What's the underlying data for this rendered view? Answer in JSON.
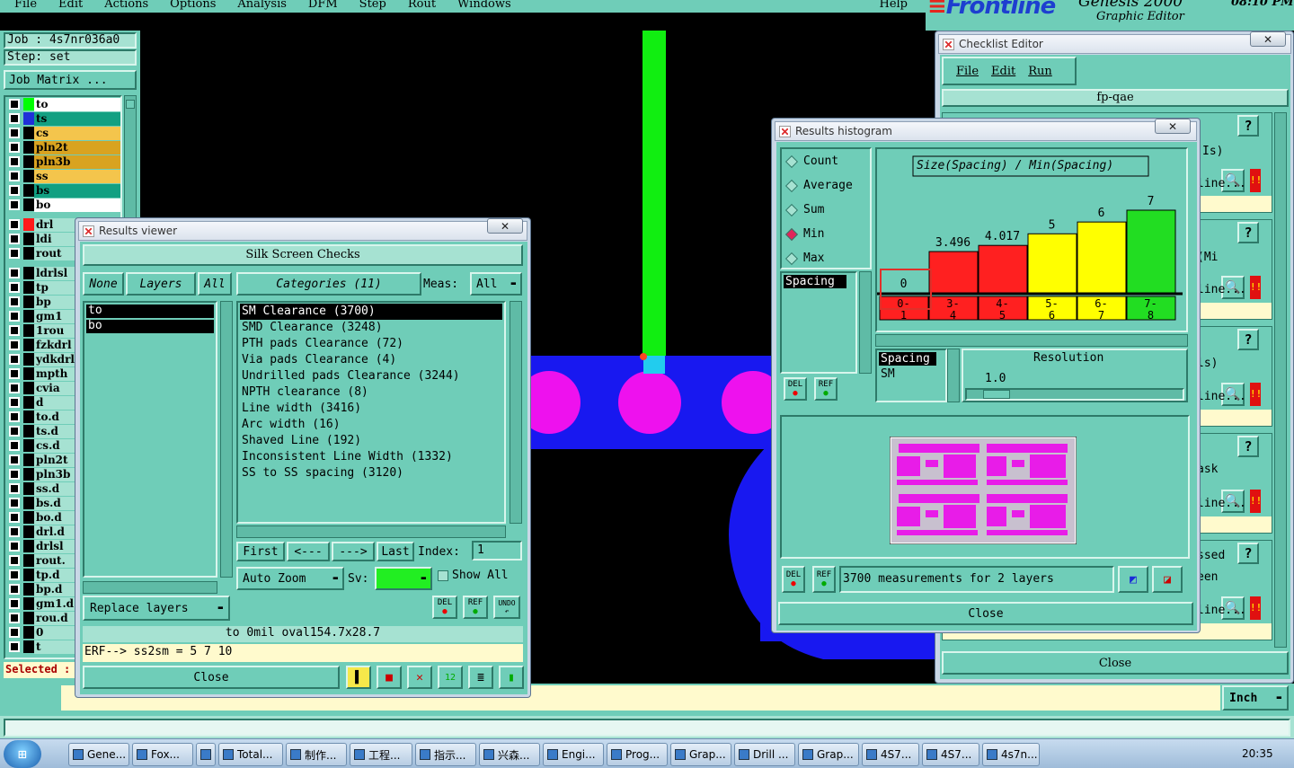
{
  "menubar": {
    "items": [
      "File",
      "Edit",
      "Actions",
      "Options",
      "Analysis",
      "DFM",
      "Step",
      "Rout",
      "Windows"
    ],
    "help": "Help"
  },
  "brand": {
    "logo": "Frontline",
    "product": "Genesis 2000",
    "subtitle": "Graphic Editor",
    "clock": "08:10 PM"
  },
  "job": {
    "job_label": "Job : 4s7nr036a0",
    "step_label": "Step: set",
    "matrix_button": "Job Matrix ..."
  },
  "layers": [
    {
      "name": "to",
      "color": "#ffffff",
      "indicator": "#00ff00"
    },
    {
      "name": "ts",
      "color": "#12a082",
      "indicator": "#1f2fd8"
    },
    {
      "name": "cs",
      "color": "#f4c54c",
      "indicator": ""
    },
    {
      "name": "pln2t",
      "color": "#d9a320",
      "indicator": ""
    },
    {
      "name": "pln3b",
      "color": "#d9a320",
      "indicator": ""
    },
    {
      "name": "ss",
      "color": "#f4c54c",
      "indicator": ""
    },
    {
      "name": "bs",
      "color": "#12a082",
      "indicator": ""
    },
    {
      "name": "bo",
      "color": "#ffffff",
      "indicator": ""
    },
    {
      "name": "drl",
      "color": "#a6e2d2",
      "indicator": "#ff1a1a"
    },
    {
      "name": "ldi",
      "color": "#a6e2d2",
      "indicator": ""
    },
    {
      "name": "rout",
      "color": "#a6e2d2",
      "indicator": ""
    },
    {
      "name": "ldrlsl",
      "color": "#a6e2d2",
      "indicator": ""
    },
    {
      "name": "tp",
      "color": "#a6e2d2",
      "indicator": ""
    },
    {
      "name": "bp",
      "color": "#a6e2d2",
      "indicator": ""
    },
    {
      "name": "gm1",
      "color": "#a6e2d2",
      "indicator": ""
    },
    {
      "name": "1rou",
      "color": "#a6e2d2",
      "indicator": ""
    },
    {
      "name": "fzkdrl",
      "color": "#a6e2d2",
      "indicator": ""
    },
    {
      "name": "ydkdrl",
      "color": "#a6e2d2",
      "indicator": ""
    },
    {
      "name": "mpth",
      "color": "#a6e2d2",
      "indicator": ""
    },
    {
      "name": "cvia",
      "color": "#a6e2d2",
      "indicator": ""
    },
    {
      "name": "d",
      "color": "#a6e2d2",
      "indicator": ""
    },
    {
      "name": "to.d",
      "color": "#a6e2d2",
      "indicator": ""
    },
    {
      "name": "ts.d",
      "color": "#a6e2d2",
      "indicator": ""
    },
    {
      "name": "cs.d",
      "color": "#a6e2d2",
      "indicator": ""
    },
    {
      "name": "pln2t",
      "color": "#a6e2d2",
      "indicator": ""
    },
    {
      "name": "pln3b",
      "color": "#a6e2d2",
      "indicator": ""
    },
    {
      "name": "ss.d",
      "color": "#a6e2d2",
      "indicator": ""
    },
    {
      "name": "bs.d",
      "color": "#a6e2d2",
      "indicator": ""
    },
    {
      "name": "bo.d",
      "color": "#a6e2d2",
      "indicator": ""
    },
    {
      "name": "drl.d",
      "color": "#a6e2d2",
      "indicator": ""
    },
    {
      "name": "drlsl",
      "color": "#a6e2d2",
      "indicator": ""
    },
    {
      "name": "rout.",
      "color": "#a6e2d2",
      "indicator": ""
    },
    {
      "name": "tp.d",
      "color": "#a6e2d2",
      "indicator": ""
    },
    {
      "name": "bp.d",
      "color": "#a6e2d2",
      "indicator": ""
    },
    {
      "name": "gm1.d",
      "color": "#a6e2d2",
      "indicator": ""
    },
    {
      "name": "rou.d",
      "color": "#a6e2d2",
      "indicator": ""
    },
    {
      "name": "0",
      "color": "#a6e2d2",
      "indicator": ""
    },
    {
      "name": "t",
      "color": "#a6e2d2",
      "indicator": ""
    }
  ],
  "selected_label": "Selected :",
  "results_viewer": {
    "title": "Results viewer",
    "header": "Silk Screen Checks",
    "btn_none": "None",
    "btn_layers": "Layers",
    "btn_all": "All",
    "categories_label": "Categories (11)",
    "meas_label": "Meas:",
    "meas_value": "All",
    "layer_list": [
      "to",
      "bo"
    ],
    "categories": [
      "SM Clearance (3700)",
      "SMD Clearance (3248)",
      "PTH pads Clearance (72)",
      "Via pads Clearance (4)",
      "Undrilled pads Clearance (3244)",
      "NPTH clearance (8)",
      "Line width (3416)",
      "Arc width (16)",
      "Shaved Line (192)",
      "Inconsistent Line Width (1332)",
      "SS to SS spacing (3120)"
    ],
    "first": "First",
    "prev": "<---",
    "next": "--->",
    "last": "Last",
    "index_label": "Index:",
    "index_value": "1",
    "auto_zoom": "Auto Zoom",
    "sv_label": "Sv:",
    "show_all": "Show All",
    "replace_layers": "Replace layers",
    "del": "DEL",
    "ref": "REF",
    "undo": "UNDO",
    "status1": "to 0mil  oval154.7x28.7",
    "status2": "ERF--> ss2sm = 5 7 10",
    "close": "Close"
  },
  "histogram": {
    "title": "Results histogram",
    "options": [
      "Count",
      "Average",
      "Sum",
      "Min",
      "Max"
    ],
    "selected_option": "Min",
    "chart_title": "Size(Spacing) / Min(Spacing)",
    "list_item": "Spacing",
    "bins": [
      {
        "range_top": "0-",
        "range_bottom": "1",
        "value": 0,
        "label": "0",
        "color": "#ff2020"
      },
      {
        "range_top": "3-",
        "range_bottom": "4",
        "value": 3.496,
        "label": "3.496",
        "color": "#ff2020"
      },
      {
        "range_top": "4-",
        "range_bottom": "5",
        "value": 4.017,
        "label": "4.017",
        "color": "#ff2020"
      },
      {
        "range_top": "5-",
        "range_bottom": "6",
        "value": 5,
        "label": "5",
        "color": "#ffff00"
      },
      {
        "range_top": "6-",
        "range_bottom": "7",
        "value": 6,
        "label": "6",
        "color": "#ffff00"
      },
      {
        "range_top": "7-",
        "range_bottom": "8",
        "value": 7,
        "label": "7",
        "color": "#22dd22"
      }
    ],
    "spacing_label": "Spacing",
    "sm_label": "SM",
    "resolution_label": "Resolution",
    "resolution_value": "1.0",
    "del": "DEL",
    "ref": "REF",
    "summary": "3700 measurements for 2 layers",
    "close": "Close"
  },
  "checklist": {
    "title": "Checklist Editor",
    "menu": [
      "File",
      "Edit",
      "Run"
    ],
    "name": "fp-qae",
    "right_labels": [
      "Is)",
      "line...",
      "(Mi",
      "line...",
      "ls)",
      "line...",
      "ask",
      "line...",
      "ssed",
      "een",
      "line..."
    ],
    "q": "?",
    "close": "Close"
  },
  "bottom": {
    "unit": "Inch"
  },
  "taskbar": {
    "items": [
      "Gene...",
      "Fox...",
      "",
      "Total...",
      "制作...",
      "工程...",
      "指示...",
      "兴森...",
      "Engi...",
      "Prog...",
      "Grap...",
      "Drill ...",
      "Grap...",
      "4S7...",
      "4S7...",
      "4s7n..."
    ],
    "time": "20:35"
  }
}
